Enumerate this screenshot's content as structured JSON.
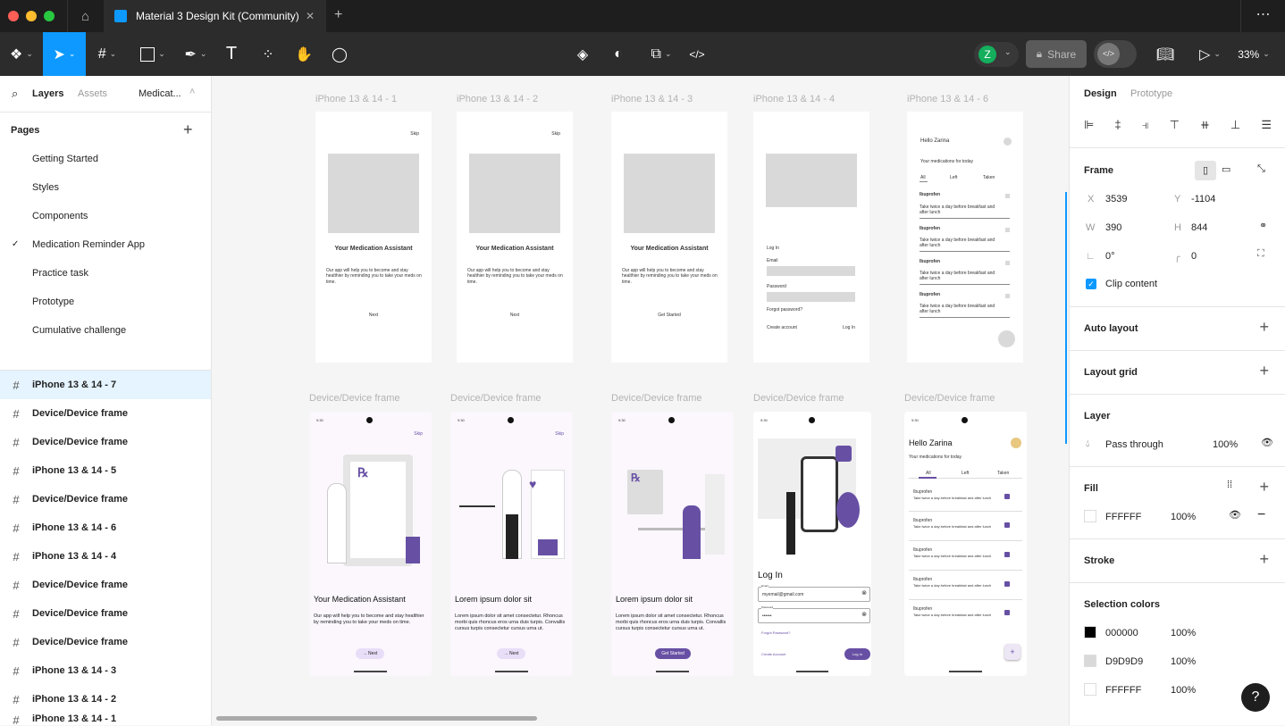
{
  "tab": {
    "title": "Material 3 Design Kit (Community)",
    "close": "✕",
    "new": "+"
  },
  "toolbar": {
    "share": "Share",
    "avatar": "Z",
    "zoom": "33%",
    "more": "⋯"
  },
  "left": {
    "tabs": [
      "Layers",
      "Assets"
    ],
    "file": "Medicat...",
    "pages_title": "Pages",
    "pages": [
      "Getting Started",
      "Styles",
      "Components",
      "Medication Reminder App",
      "Practice task",
      "Prototype",
      "Cumulative challenge"
    ],
    "current_page": "✓",
    "layers": [
      "iPhone 13 & 14 - 7",
      "Device/Device frame",
      "Device/Device frame",
      "iPhone 13 & 14 - 5",
      "Device/Device frame",
      "iPhone 13 & 14 - 6",
      "iPhone 13 & 14 - 4",
      "Device/Device frame",
      "Device/Device frame",
      "Device/Device frame",
      "iPhone 13 & 14 - 3",
      "iPhone 13 & 14 - 2",
      "iPhone 13 & 14 - 1"
    ]
  },
  "canvas": {
    "row1": [
      "iPhone 13 & 14 - 1",
      "iPhone 13 & 14 - 2",
      "iPhone 13 & 14 - 3",
      "iPhone 13 & 14 - 4",
      "iPhone 13 & 14 - 6"
    ],
    "row2": [
      "Device/Device frame",
      "Device/Device frame",
      "Device/Device frame",
      "Device/Device frame",
      "Device/Device frame"
    ],
    "wire": {
      "skip": "Skip",
      "title": "Your Medication Assistant",
      "body": "Our app will help you to become and stay healthier by reminding you to take your meds on time.",
      "next": "Next",
      "get_started": "Get Started",
      "login": {
        "title": "Log In",
        "email": "Email",
        "password": "Password",
        "forgot": "Forgot password?",
        "create": "Create account",
        "login": "Log In"
      },
      "home": {
        "hello": "Hello Zarina",
        "sub": "Your medications for today",
        "tabs": [
          "All",
          "Left",
          "Taken"
        ],
        "med": "Ibuprofen",
        "desc": "Take twice a day before breakfast and after lunch"
      }
    },
    "dev": {
      "time": "9:30",
      "skip": "Skip",
      "titles": [
        "Your Medication Assistant",
        "Lorem ipsum dolor sit",
        "Lorem ipsum dolor sit"
      ],
      "bodies": [
        "Our app will help you to become and stay healthier by reminding you to take your meds on time.",
        "Lorem ipsum dolor sit amet consectetur. Rhoncus morbi quis rhoncus eros urna duis turpis. Convallis cursus turpis consectetur cursus urna ut.",
        "Lorem ipsum dolor sit amet consectetur. Rhoncus morbi quis rhoncus eros urna duis turpis. Convallis cursus turpis consectetur cursus urna ut."
      ],
      "next": "→ Next",
      "get_started": "Get Started",
      "login": {
        "title": "Log In",
        "email_label": "Email",
        "email": "myemail@gmail.com",
        "password_label": "Password",
        "password": "••••••",
        "forgot": "Forgot Password?",
        "create": "Create Account",
        "login": "Log In"
      },
      "home": {
        "hello": "Hello Zarina",
        "sub": "Your medications for today",
        "tabs": [
          "All",
          "Left",
          "Taken"
        ],
        "med": "Ibuprofen",
        "desc": "Take twice a day before breakfast and after lunch",
        "fab": "+"
      }
    }
  },
  "right": {
    "tabs": [
      "Design",
      "Prototype"
    ],
    "frame": "Frame",
    "x_label": "X",
    "x": "3539",
    "y_label": "Y",
    "y": "-1104",
    "w_label": "W",
    "w": "390",
    "h_label": "H",
    "h": "844",
    "rotation": "0°",
    "radius": "0",
    "clip": "Clip content",
    "auto_layout": "Auto layout",
    "layout_grid": "Layout grid",
    "layer": "Layer",
    "blend": "Pass through",
    "opacity": "100%",
    "fill": "Fill",
    "fill_hex": "FFFFFF",
    "fill_opacity": "100%",
    "stroke": "Stroke",
    "selection_colors": "Selection colors",
    "colors": [
      {
        "hex": "000000",
        "opacity": "100%",
        "color": "#000000"
      },
      {
        "hex": "D9D9D9",
        "opacity": "100%",
        "color": "#D9D9D9"
      },
      {
        "hex": "FFFFFF",
        "opacity": "100%",
        "color": "#FFFFFF"
      }
    ],
    "help": "?"
  },
  "colors": {
    "accent": "#0d99ff",
    "purple": "#6750a4",
    "avatar": "#14ae5c"
  }
}
